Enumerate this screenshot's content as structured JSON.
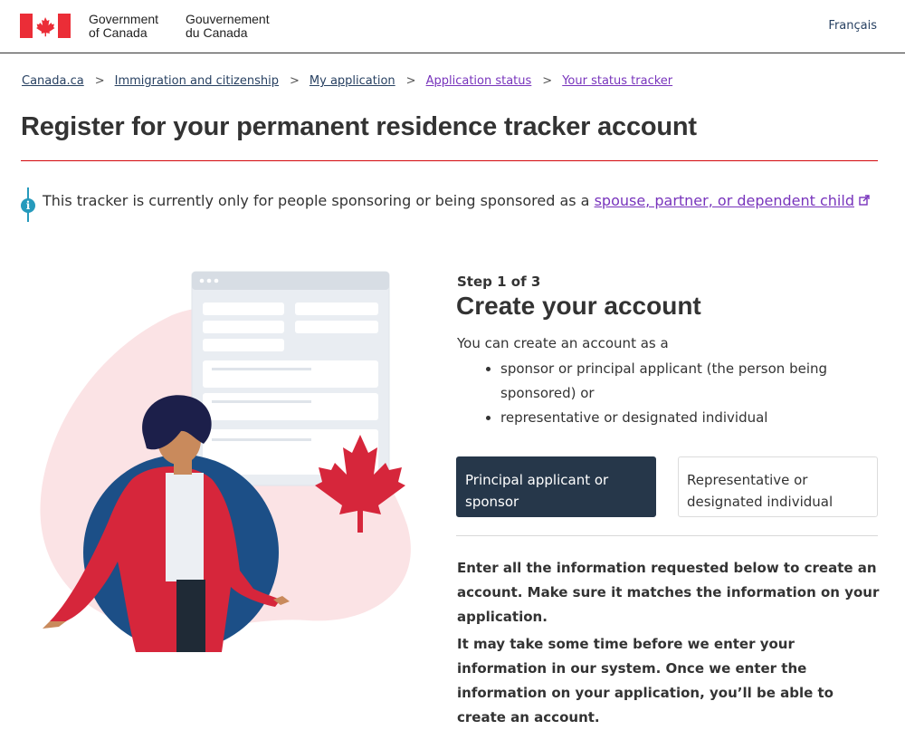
{
  "header": {
    "gov_en": "Government\nof Canada",
    "gov_fr": "Gouvernement\ndu Canada",
    "language_link": "Français",
    "colors": {
      "flag_red": "#eb2d37",
      "rule": "#333333"
    }
  },
  "breadcrumb": [
    {
      "label": "Canada.ca",
      "visited": false
    },
    {
      "label": "Immigration and citizenship",
      "visited": false
    },
    {
      "label": "My application",
      "visited": false
    },
    {
      "label": "Application status",
      "visited": true
    },
    {
      "label": "Your status tracker",
      "visited": true
    }
  ],
  "page": {
    "title": "Register for your permanent residence tracker account",
    "accent_rule_color": "#d3080c"
  },
  "alert": {
    "icon": "info-icon",
    "text": "This tracker is currently only for people sponsoring or being sponsored as a ",
    "link": "spouse, partner, or dependent child",
    "link_icon": "external-link-icon"
  },
  "form": {
    "step": "Step 1 of 3",
    "title": "Create your account",
    "intro": "You can create an account as a",
    "options": [
      "sponsor or principal applicant (the person being sponsored) or",
      "representative or designated individual"
    ],
    "buttons": {
      "primary": "Principal applicant or sponsor",
      "secondary": "Representative or designated individual"
    },
    "paragraph_1": "Enter all the information requested below to create an account. Make sure it matches the information on your application.",
    "paragraph_2": "It may take some time before we enter your information in our system. Once we enter the information on your application, you’ll be able to create an account."
  },
  "colors": {
    "link": "#284162",
    "visited_link": "#7834bc",
    "primary_button": "#26374a",
    "info": "#269abc"
  }
}
